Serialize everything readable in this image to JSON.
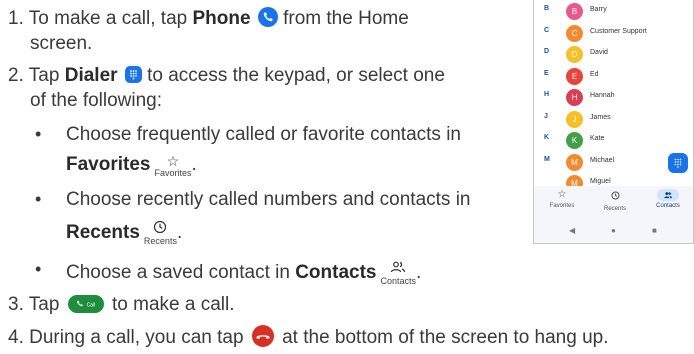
{
  "steps": {
    "s1": {
      "num": "1.",
      "pre": "To make a call, tap ",
      "bold": "Phone",
      "post": " from the Home",
      "cont": "screen."
    },
    "s2": {
      "num": "2.",
      "pre": "Tap ",
      "bold": "Dialer",
      "post": " to access the keypad, or select one",
      "cont": "of the following:"
    },
    "b1": {
      "text": "Choose frequently called or favorite contacts in",
      "bold": "Favorites",
      "icon_label": "Favorites",
      "end": "."
    },
    "b2": {
      "text": "Choose recently called numbers and contacts in",
      "bold": "Recents",
      "icon_label": "Recents",
      "end": "."
    },
    "b3": {
      "pre": "Choose a saved contact in ",
      "bold": "Contacts",
      "icon_label": "Contacts",
      "end": "."
    },
    "s3": {
      "num": "3.",
      "pre": "Tap ",
      "pill_label": "Call",
      "post": " to make a call."
    },
    "s4": {
      "num": "4.",
      "pre": "During a call, you can tap ",
      "post": " at the bottom of the screen to hang up."
    }
  },
  "phone": {
    "contacts": [
      {
        "letter": "B",
        "initial": "B",
        "name": "Barry",
        "color": "#e8588b"
      },
      {
        "letter": "C",
        "initial": "C",
        "name": "Customer Support",
        "color": "#f28b30"
      },
      {
        "letter": "D",
        "initial": "D",
        "name": "David",
        "color": "#f6c026"
      },
      {
        "letter": "E",
        "initial": "E",
        "name": "Ed",
        "color": "#e8453c"
      },
      {
        "letter": "H",
        "initial": "H",
        "name": "Hannah",
        "color": "#d93f53"
      },
      {
        "letter": "J",
        "initial": "J",
        "name": "James",
        "color": "#f6c026"
      },
      {
        "letter": "K",
        "initial": "K",
        "name": "Kate",
        "color": "#43a047"
      },
      {
        "letter": "M",
        "initial": "M",
        "name": "Michael",
        "color": "#f28b30"
      },
      {
        "letter": "",
        "initial": "M",
        "name": "Miguel",
        "color": "#f28b30"
      }
    ],
    "tabs": {
      "favorites": "Favorites",
      "recents": "Recents",
      "contacts": "Contacts"
    }
  },
  "colors": {
    "accent": "#1a73e8",
    "call_green": "#1e8e3e",
    "hangup_red": "#d93025"
  }
}
